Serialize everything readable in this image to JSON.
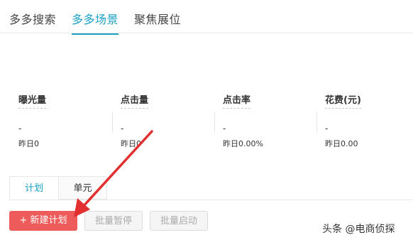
{
  "top_tabs": [
    "多多搜索",
    "多多场景",
    "聚焦展位"
  ],
  "active_top_tab": "多多场景",
  "stats": [
    {
      "label": "曝光量",
      "value": "-",
      "sub": "昨日0"
    },
    {
      "label": "点击量",
      "value": "-",
      "sub": "昨日0"
    },
    {
      "label": "点击率",
      "value": "-",
      "sub": "昨日0.00%"
    },
    {
      "label": "花费(元)",
      "value": "-",
      "sub": "昨日0.00"
    }
  ],
  "sub_tabs": [
    "计划",
    "单元"
  ],
  "active_sub_tab": "计划",
  "buttons": {
    "new_plan": "+ 新建计划",
    "batch_pause": "批量暂停",
    "batch_start": "批量启动"
  },
  "watermark": "头条 @电商侦探",
  "colors": {
    "accent": "#1aa0c4",
    "primary_button": "#ee5b5b",
    "arrow": "#e23030"
  }
}
